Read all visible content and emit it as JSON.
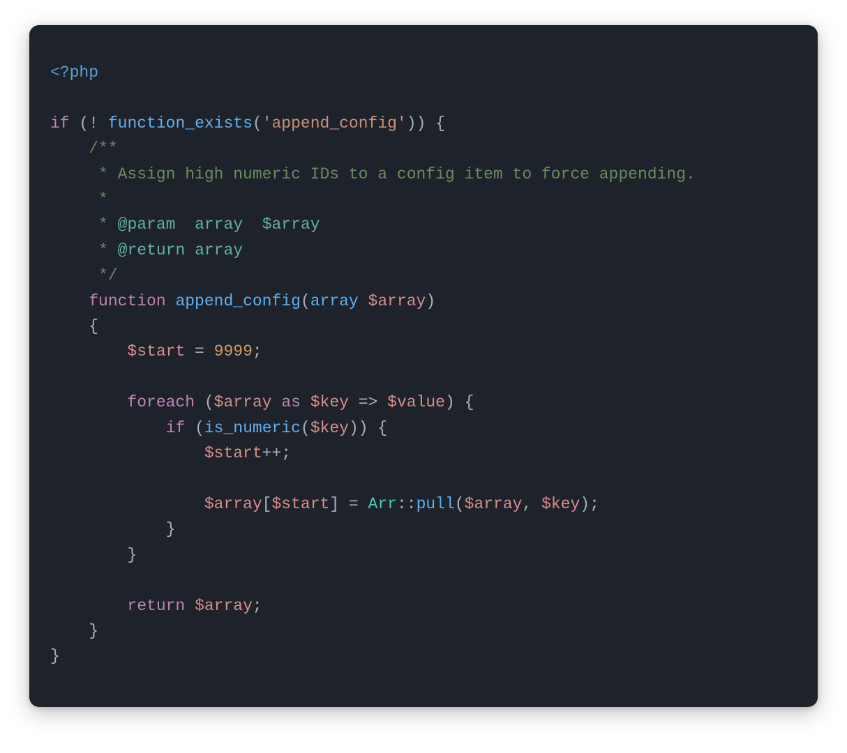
{
  "code": {
    "open": "<?php",
    "blank": "",
    "kw_if": "if",
    "kw_function": "function",
    "kw_foreach": "foreach",
    "kw_as": "as",
    "kw_return": "return",
    "fn_exists": "function_exists",
    "fn_append": "append_config",
    "fn_is_numeric": "is_numeric",
    "fn_pull": "pull",
    "class_arr": "Arr",
    "type_array": "array",
    "str_append": "'append_config'",
    "var_array": "$array",
    "var_start": "$start",
    "var_key": "$key",
    "var_value": "$value",
    "num_9999": "9999",
    "op_not": "! ",
    "op_eq": " = ",
    "op_arrow": " => ",
    "op_pp": "++",
    "op_scope": "::",
    "p_open": "(",
    "p_close": ")",
    "b_open": "{",
    "b_close": "}",
    "sq_open": "[",
    "sq_close": "]",
    "semi": ";",
    "comma": ", ",
    "sp": " ",
    "i1": "    ",
    "i2": "        ",
    "i3": "            ",
    "i4": "                ",
    "doc_open": "/**",
    "doc_star": " *",
    "doc_close": " */",
    "doc_desc": " Assign high numeric IDs to a config item to force appending.",
    "doc_param_tag": "@param",
    "doc_return_tag": "@return",
    "doc_type_array": "array",
    "doc_var_array": "$array",
    "doc_param_sp1": "  ",
    "doc_param_sp2": "  "
  }
}
